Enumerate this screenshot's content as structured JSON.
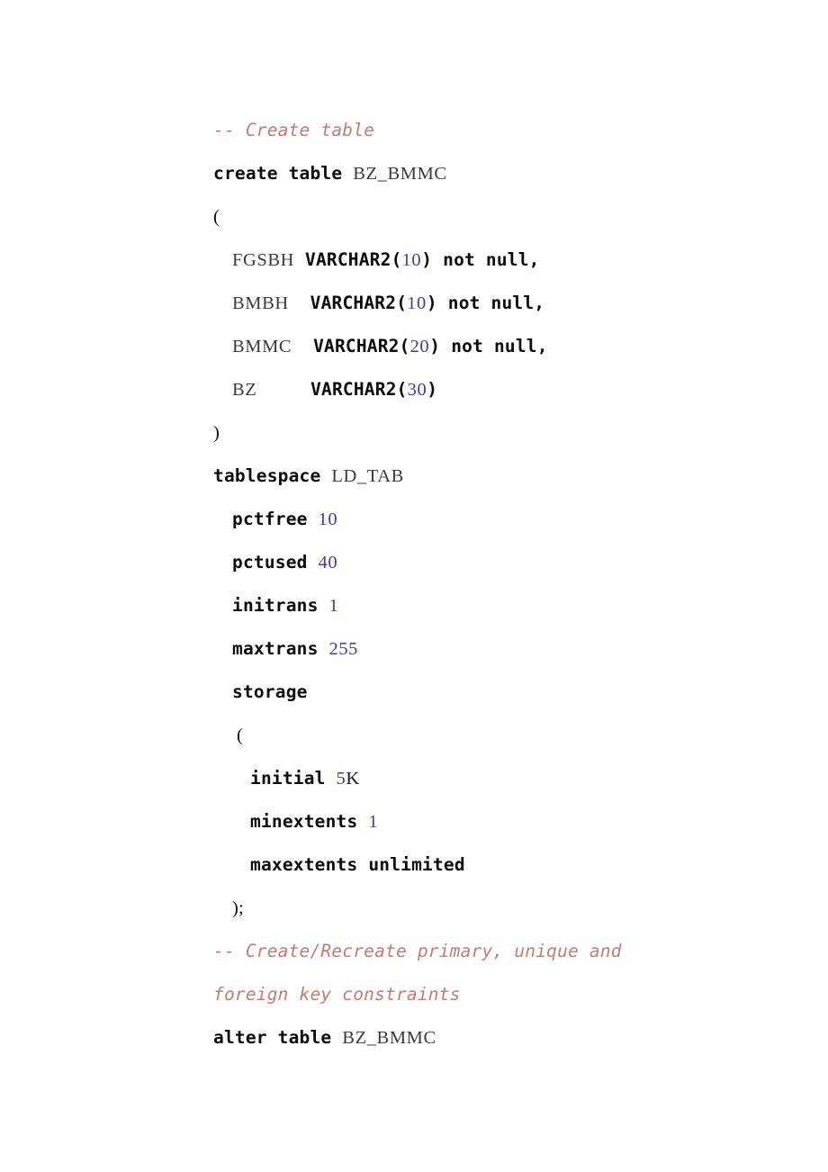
{
  "document": {
    "kind": "sql-ddl-script",
    "language": "Oracle SQL",
    "background_color": "#ffffff",
    "colors": {
      "comment": "#c47b74",
      "keyword": "#0b0b0b",
      "identifier": "#3a3a3a",
      "number": "#3f3f8f",
      "punctuation": "#0b0b0b"
    },
    "table_name": "BZ_BMMC",
    "tablespace_name": "LD_TAB"
  },
  "lines": [
    {
      "id": "comment-create-table",
      "indent": 0,
      "tokens": [
        {
          "t": "comment",
          "v": "-- Create table"
        }
      ]
    },
    {
      "id": "create-table-stmt",
      "indent": 0,
      "tokens": [
        {
          "t": "keyword",
          "v": "create table"
        },
        {
          "t": "space",
          "v": " "
        },
        {
          "t": "ident",
          "v": "BZ_BMMC"
        }
      ]
    },
    {
      "id": "open-paren-columns",
      "indent": 0,
      "tokens": [
        {
          "t": "punct",
          "v": "("
        }
      ]
    },
    {
      "id": "column-fgsbh",
      "indent": 1,
      "tokens": [
        {
          "t": "ident",
          "v": "FGSBH"
        },
        {
          "t": "space",
          "v": " "
        },
        {
          "t": "keyword",
          "v": "VARCHAR2"
        },
        {
          "t": "punct-bold",
          "v": "("
        },
        {
          "t": "number",
          "v": "10"
        },
        {
          "t": "punct-bold",
          "v": ")"
        },
        {
          "t": "space",
          "v": " "
        },
        {
          "t": "keyword",
          "v": "not null,"
        }
      ]
    },
    {
      "id": "column-bmbh",
      "indent": 1,
      "tokens": [
        {
          "t": "ident",
          "v": "BMBH"
        },
        {
          "t": "space",
          "v": "  "
        },
        {
          "t": "keyword",
          "v": "VARCHAR2"
        },
        {
          "t": "punct-bold",
          "v": "("
        },
        {
          "t": "number",
          "v": "10"
        },
        {
          "t": "punct-bold",
          "v": ")"
        },
        {
          "t": "space",
          "v": " "
        },
        {
          "t": "keyword",
          "v": "not null,"
        }
      ]
    },
    {
      "id": "column-bmmc",
      "indent": 1,
      "tokens": [
        {
          "t": "ident",
          "v": "BMMC"
        },
        {
          "t": "space",
          "v": "  "
        },
        {
          "t": "keyword",
          "v": "VARCHAR2"
        },
        {
          "t": "punct-bold",
          "v": "("
        },
        {
          "t": "number",
          "v": "20"
        },
        {
          "t": "punct-bold",
          "v": ")"
        },
        {
          "t": "space",
          "v": " "
        },
        {
          "t": "keyword",
          "v": "not null,"
        }
      ]
    },
    {
      "id": "column-bz",
      "indent": 1,
      "tokens": [
        {
          "t": "ident",
          "v": "BZ"
        },
        {
          "t": "space",
          "v": "     "
        },
        {
          "t": "keyword",
          "v": "VARCHAR2"
        },
        {
          "t": "punct-bold",
          "v": "("
        },
        {
          "t": "number",
          "v": "30"
        },
        {
          "t": "punct-bold",
          "v": ")"
        }
      ]
    },
    {
      "id": "close-paren-columns",
      "indent": 0,
      "tokens": [
        {
          "t": "punct",
          "v": ")"
        }
      ]
    },
    {
      "id": "tablespace-clause",
      "indent": 0,
      "tokens": [
        {
          "t": "keyword",
          "v": "tablespace"
        },
        {
          "t": "space",
          "v": " "
        },
        {
          "t": "ident",
          "v": "LD_TAB"
        }
      ]
    },
    {
      "id": "pctfree-clause",
      "indent": 1,
      "tokens": [
        {
          "t": "keyword",
          "v": "pctfree"
        },
        {
          "t": "space",
          "v": " "
        },
        {
          "t": "number",
          "v": "10"
        }
      ]
    },
    {
      "id": "pctused-clause",
      "indent": 1,
      "tokens": [
        {
          "t": "keyword",
          "v": "pctused"
        },
        {
          "t": "space",
          "v": " "
        },
        {
          "t": "number",
          "v": "40"
        }
      ]
    },
    {
      "id": "initrans-clause",
      "indent": 1,
      "tokens": [
        {
          "t": "keyword",
          "v": "initrans"
        },
        {
          "t": "space",
          "v": " "
        },
        {
          "t": "number",
          "v": "1"
        }
      ]
    },
    {
      "id": "maxtrans-clause",
      "indent": 1,
      "tokens": [
        {
          "t": "keyword",
          "v": "maxtrans"
        },
        {
          "t": "space",
          "v": " "
        },
        {
          "t": "number",
          "v": "255"
        }
      ]
    },
    {
      "id": "storage-clause",
      "indent": 1,
      "tokens": [
        {
          "t": "keyword",
          "v": "storage"
        }
      ]
    },
    {
      "id": "open-paren-storage",
      "indent": 2,
      "tokens": [
        {
          "t": "punct",
          "v": "("
        }
      ]
    },
    {
      "id": "initial-clause",
      "indent": 3,
      "tokens": [
        {
          "t": "keyword",
          "v": "initial"
        },
        {
          "t": "space",
          "v": " "
        },
        {
          "t": "number",
          "v": "5"
        },
        {
          "t": "plain",
          "v": "K"
        }
      ]
    },
    {
      "id": "minextents-clause",
      "indent": 3,
      "tokens": [
        {
          "t": "keyword",
          "v": "minextents"
        },
        {
          "t": "space",
          "v": " "
        },
        {
          "t": "number",
          "v": "1"
        }
      ]
    },
    {
      "id": "maxextents-clause",
      "indent": 3,
      "tokens": [
        {
          "t": "keyword",
          "v": "maxextents unlimited"
        }
      ]
    },
    {
      "id": "close-paren-storage",
      "indent": 1,
      "tokens": [
        {
          "t": "punct",
          "v": ");"
        }
      ]
    },
    {
      "id": "comment-constraints-line1",
      "indent": 0,
      "tokens": [
        {
          "t": "comment",
          "v": "-- Create/Recreate primary, unique and"
        }
      ]
    },
    {
      "id": "comment-constraints-line2",
      "indent": 0,
      "tokens": [
        {
          "t": "comment",
          "v": "foreign key constraints"
        }
      ]
    },
    {
      "id": "alter-table-stmt",
      "indent": 0,
      "tokens": [
        {
          "t": "keyword",
          "v": "alter table"
        },
        {
          "t": "space",
          "v": " "
        },
        {
          "t": "ident",
          "v": "BZ_BMMC"
        }
      ]
    }
  ]
}
